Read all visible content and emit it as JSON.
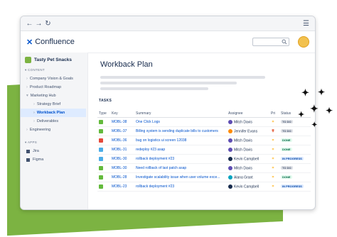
{
  "app": {
    "name": "Confluence",
    "logo_glyph": "✕"
  },
  "browser": {
    "back": "←",
    "forward": "→",
    "refresh": "↻",
    "menu": "☰"
  },
  "sidebar": {
    "space_name": "Tasty Pet Snacks",
    "content_label": "CONTENT",
    "items": [
      {
        "label": "Company Vision & Goals"
      },
      {
        "label": "Product Roadmap"
      },
      {
        "label": "Marketing Hub"
      },
      {
        "label": "Strategy Brief"
      },
      {
        "label": "Workback Plan"
      },
      {
        "label": "Deliverables"
      },
      {
        "label": "Engineering"
      }
    ],
    "apps_label": "APPS",
    "apps": [
      {
        "label": "Jira"
      },
      {
        "label": "Figma"
      }
    ]
  },
  "main": {
    "title": "Workback Plan",
    "tasks_label": "TASKS"
  },
  "table": {
    "headers": {
      "type": "Type",
      "key": "Key",
      "summary": "Summary",
      "assignee": "Assignee",
      "priority": "Pri",
      "status": "Status"
    },
    "rows": [
      {
        "type": "story",
        "key": "MOBL-38",
        "summary": "One Click Logs",
        "assignee": "Mitch Davis",
        "avatar_color": "#5e4db2",
        "priority": "medium",
        "priority_glyph": "=",
        "priority_color": "#ffab00",
        "status": "TO DO",
        "status_color": "#42526e",
        "status_bg": "#dfe1e6"
      },
      {
        "type": "story",
        "key": "MOBL-37",
        "summary": "Billing system is sending duplicate bills to customers",
        "assignee": "Jennifer Evans",
        "avatar_color": "#ff8b00",
        "priority": "highest",
        "priority_glyph": "⇈",
        "priority_color": "#de350b",
        "status": "TO DO",
        "status_color": "#42526e",
        "status_bg": "#dfe1e6"
      },
      {
        "type": "bug",
        "key": "MOBL-36",
        "summary": "bug on logistics ui screen 12038",
        "assignee": "Mitch Davis",
        "avatar_color": "#5e4db2",
        "priority": "medium",
        "priority_glyph": "=",
        "priority_color": "#ffab00",
        "status": "DONE",
        "status_color": "#006644",
        "status_bg": "#e3fcef"
      },
      {
        "type": "task",
        "key": "MOBL-31",
        "summary": "redeploy #23 asap",
        "assignee": "Mitch Davis",
        "avatar_color": "#5e4db2",
        "priority": "medium",
        "priority_glyph": "=",
        "priority_color": "#ffab00",
        "status": "DONE",
        "status_color": "#006644",
        "status_bg": "#e3fcef"
      },
      {
        "type": "task",
        "key": "MOBL-30",
        "summary": "rollback deployment #23",
        "assignee": "Kevin Campbell",
        "avatar_color": "#172b4d",
        "priority": "medium",
        "priority_glyph": "=",
        "priority_color": "#ffab00",
        "status": "IN PROGRESS",
        "status_color": "#0747a6",
        "status_bg": "#deebff"
      },
      {
        "type": "story",
        "key": "MOBL-30",
        "summary": "Need rollback of last patch asap",
        "assignee": "Mitch Davis",
        "avatar_color": "#5e4db2",
        "priority": "medium",
        "priority_glyph": "=",
        "priority_color": "#ffab00",
        "status": "TO DO",
        "status_color": "#42526e",
        "status_bg": "#dfe1e6"
      },
      {
        "type": "story",
        "key": "MOBL-28",
        "summary": "Investigate scalability issue when user volume exce...",
        "assignee": "Alana Grant",
        "avatar_color": "#00a3bf",
        "priority": "medium",
        "priority_glyph": "=",
        "priority_color": "#ffab00",
        "status": "DONE",
        "status_color": "#006644",
        "status_bg": "#e3fcef"
      },
      {
        "type": "story",
        "key": "MOBL-23",
        "summary": "rollback deployment #23",
        "assignee": "Kevin Campbell",
        "avatar_color": "#172b4d",
        "priority": "medium",
        "priority_glyph": "=",
        "priority_color": "#ffab00",
        "status": "IN PROGRESS",
        "status_color": "#0747a6",
        "status_bg": "#deebff"
      }
    ]
  },
  "colors": {
    "accent_green": "#7cb342",
    "brand_blue": "#0052cc"
  }
}
